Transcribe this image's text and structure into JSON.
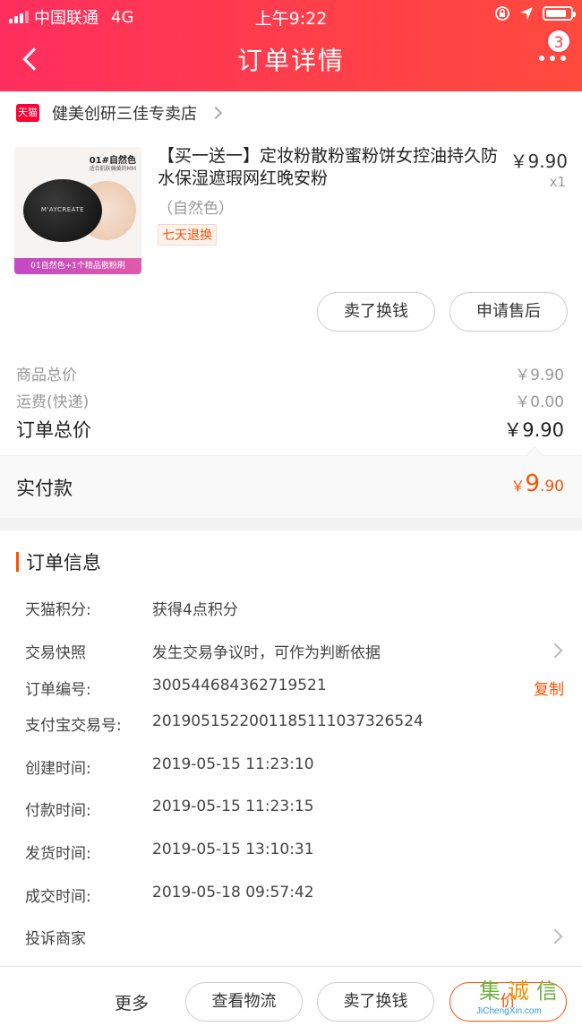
{
  "status_bar": {
    "carrier": "中国联通",
    "network": "4G",
    "time": "上午9:22"
  },
  "nav": {
    "title": "订单详情",
    "badge_count": "3"
  },
  "shop": {
    "logo_text": "天猫",
    "name": "健美创研三佳专卖店"
  },
  "product": {
    "image_text": {
      "top": "01#自然色",
      "sub": "适合肌肤偏黄的MM",
      "brand": "M'AYCREATE",
      "footer": "01自然色+1个精品散粉刷"
    },
    "title": "【买一送一】定妆粉散粉蜜粉饼女控油持久防水保湿遮瑕网红晚安粉",
    "variant": "（自然色）",
    "tag": "七天退换",
    "price": "￥9.90",
    "qty": "x1"
  },
  "actions": {
    "sell": "卖了换钱",
    "after_sale": "申请售后"
  },
  "summary": {
    "goods_label": "商品总价",
    "goods_value": "￥9.90",
    "shipping_label": "运费(快递)",
    "shipping_value": "￥0.00",
    "order_total_label": "订单总价",
    "order_total_value": "￥9.90",
    "paid_label": "实付款",
    "paid_currency": "￥",
    "paid_int": "9",
    "paid_dec": ".90"
  },
  "info": {
    "heading": "订单信息",
    "rows": [
      {
        "key": "天猫积分:",
        "value": "获得4点积分"
      },
      {
        "key": "交易快照",
        "value": "发生交易争议时，可作为判断依据"
      },
      {
        "key": "订单编号:",
        "value": "300544684362719521",
        "action": "复制"
      },
      {
        "key": "支付宝交易号:",
        "value": "2019051522001185111037326524"
      },
      {
        "key": "创建时间:",
        "value": "2019-05-15 11:23:10"
      },
      {
        "key": "付款时间:",
        "value": "2019-05-15 11:23:15"
      },
      {
        "key": "发货时间:",
        "value": "2019-05-15 13:10:31"
      },
      {
        "key": "成交时间:",
        "value": "2019-05-18 09:57:42"
      },
      {
        "key": "投诉商家",
        "value": ""
      }
    ]
  },
  "bottom": {
    "more": "更多",
    "logistics": "查看物流",
    "sell": "卖了换钱",
    "third": "价"
  },
  "watermark": {
    "chars": [
      "集",
      "诚",
      "信"
    ],
    "url": "JiChengXin.com"
  },
  "colors": {
    "brand_gradient_start": "#ff2e5e",
    "brand_gradient_end": "#ff4a3d",
    "accent_orange": "#ff5000"
  }
}
